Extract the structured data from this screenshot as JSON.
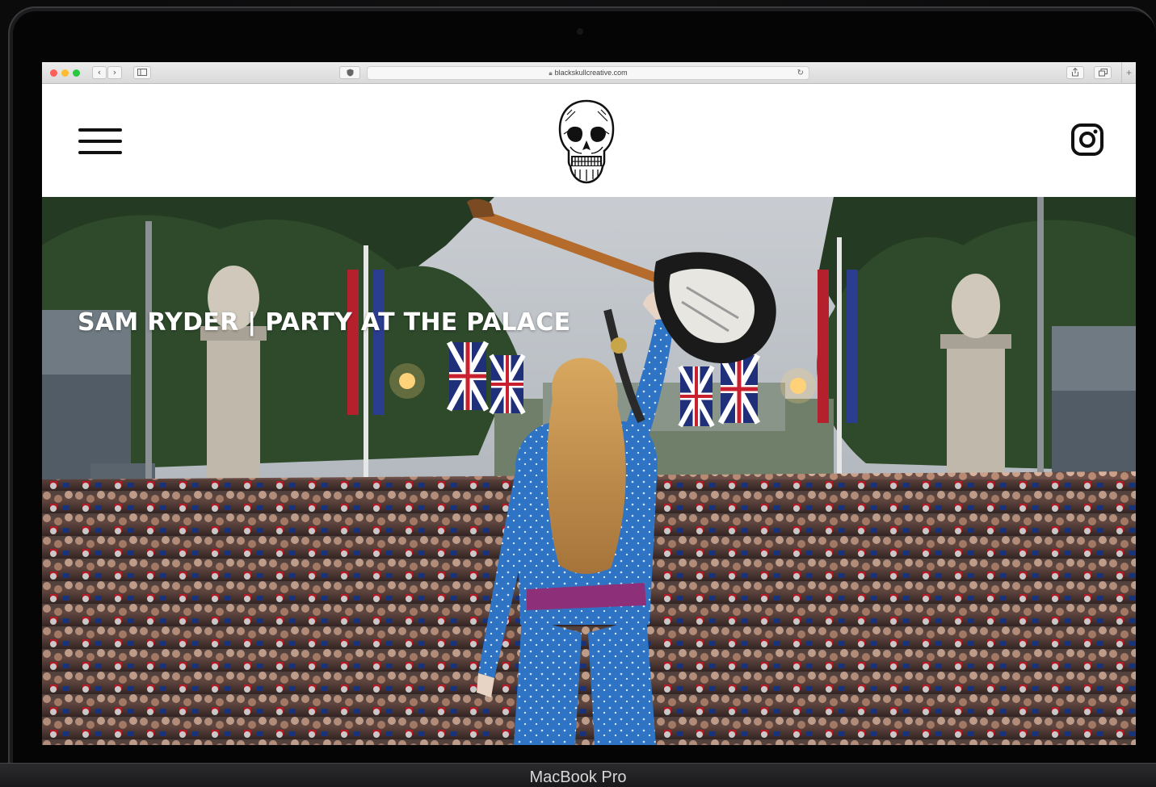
{
  "browser": {
    "url": "blackskullcreative.com",
    "lock_icon": "lock-icon",
    "back_icon": "chevron-left-icon",
    "forward_icon": "chevron-right-icon",
    "sidebar_icon": "sidebar-icon",
    "shield_icon": "shield-icon",
    "reload_icon": "reload-icon",
    "share_icon": "share-icon",
    "tabs_icon": "tabs-icon",
    "new_tab_label": "+",
    "traffic_colors": [
      "#fe5f57",
      "#febc2e",
      "#28c840"
    ]
  },
  "header": {
    "menu_icon": "hamburger-menu-icon",
    "logo_icon": "skull-logo-icon",
    "instagram_icon": "instagram-icon"
  },
  "hero": {
    "title": "SAM RYDER | PARTY AT THE PALACE",
    "image_icon": "concert-photo"
  },
  "device": {
    "label": "MacBook Pro"
  }
}
